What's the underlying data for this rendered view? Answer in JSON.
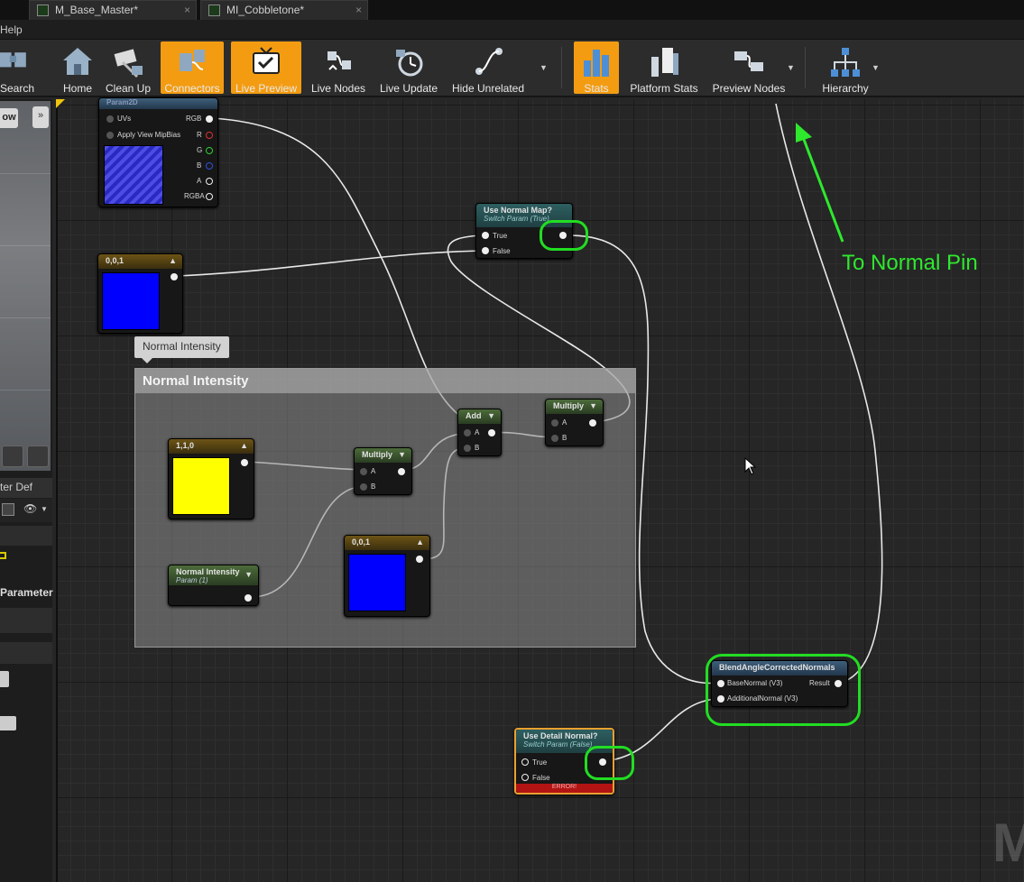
{
  "tabs": [
    {
      "label": "M_Base_Master*",
      "close": "×"
    },
    {
      "label": "MI_Cobbletone*",
      "close": "×"
    }
  ],
  "menu": {
    "help": "Help"
  },
  "toolbar": {
    "search": "Search",
    "home": "Home",
    "clean_up": "Clean Up",
    "connectors": "Connectors",
    "live_preview": "Live Preview",
    "live_nodes": "Live Nodes",
    "live_update": "Live Update",
    "hide_unrelated": "Hide Unrelated",
    "stats": "Stats",
    "platform_stats": "Platform Stats",
    "preview_nodes": "Preview Nodes",
    "hierarchy": "Hierarchy",
    "active_color": "#f39c12"
  },
  "left_panel": {
    "view_button": "ow",
    "expand_button": "»",
    "details_tab": "ter Def",
    "parameter_label": "Parameter"
  },
  "comment": {
    "bubble": "Normal Intensity",
    "title": "Normal Intensity"
  },
  "nodes": {
    "texture_sample": {
      "header": "Param2D",
      "pins": [
        "UVs",
        "Apply View MipBias"
      ],
      "outputs": [
        "RGB",
        "R",
        "G",
        "B",
        "A",
        "RGBA"
      ]
    },
    "const_001_top": {
      "header": "0,0,1",
      "color": "#0000ff"
    },
    "use_normal_map": {
      "title": "Use Normal Map?",
      "subtitle": "Switch Param (True)",
      "pins": [
        "True",
        "False"
      ]
    },
    "const_110": {
      "header": "1,1,0",
      "color": "#ffff00"
    },
    "multiply_inner": {
      "title": "Multiply",
      "pins": [
        "A",
        "B"
      ]
    },
    "add": {
      "title": "Add",
      "pins": [
        "A",
        "B"
      ]
    },
    "multiply_outer": {
      "title": "Multiply",
      "pins": [
        "A",
        "B"
      ]
    },
    "normal_intensity": {
      "title": "Normal Intensity",
      "subtitle": "Param (1)"
    },
    "const_001_inner": {
      "header": "0,0,1",
      "color": "#0000ff"
    },
    "blend_normals": {
      "title": "BlendAngleCorrectedNormals",
      "inputs": [
        "BaseNormal (V3)",
        "AdditionalNormal (V3)"
      ],
      "output": "Result"
    },
    "use_detail_normal": {
      "title": "Use Detail Normal?",
      "subtitle": "Switch Param (False)",
      "pins": [
        "True",
        "False"
      ],
      "error": "ERROR!"
    }
  },
  "annotation": {
    "text": "To Normal Pin",
    "color": "#2ee82e"
  },
  "watermark": "M"
}
